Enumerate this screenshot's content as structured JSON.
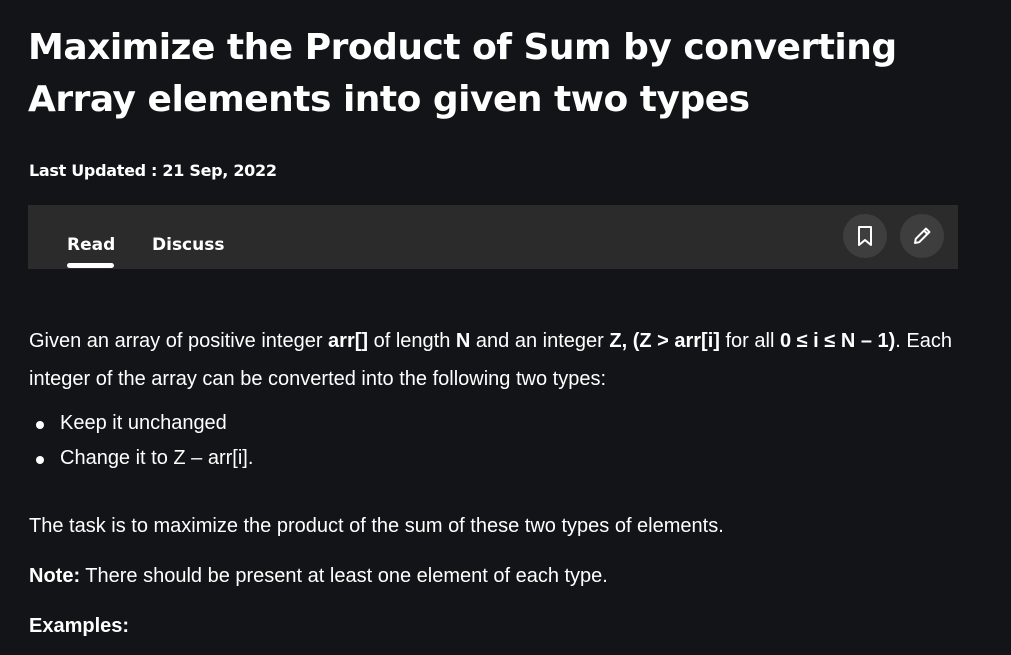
{
  "article": {
    "title": "Maximize the Product of Sum by converting Array elements into given two types",
    "last_updated": "Last Updated : 21 Sep, 2022"
  },
  "tabs": {
    "read": "Read",
    "discuss": "Discuss",
    "active": "Read"
  },
  "actions": {
    "bookmark_icon": "bookmark-icon",
    "edit_icon": "pencil-icon"
  },
  "content": {
    "p1": {
      "t1": "Given an array of positive integer ",
      "b1": "arr[]",
      "t2": " of length ",
      "b2": "N",
      "t3": " and an integer ",
      "b3": "Z, (Z > arr[i]",
      "t4": " for all ",
      "b4": "0 ≤ i ≤ N – 1)",
      "t5": ". Each integer of the array can be converted into the following two types:"
    },
    "bullets": [
      "Keep it unchanged",
      "Change it to Z – arr[i]."
    ],
    "task": "The task is to maximize the product of the sum of these two types of elements.",
    "note_label": "Note:",
    "note_text": " There should be present at least one element of each type.",
    "examples_heading": "Examples:"
  },
  "colors": {
    "background": "#131417",
    "tabbar": "#2b2b2b",
    "icon_button": "#3e3e3e",
    "text": "#ffffff"
  }
}
